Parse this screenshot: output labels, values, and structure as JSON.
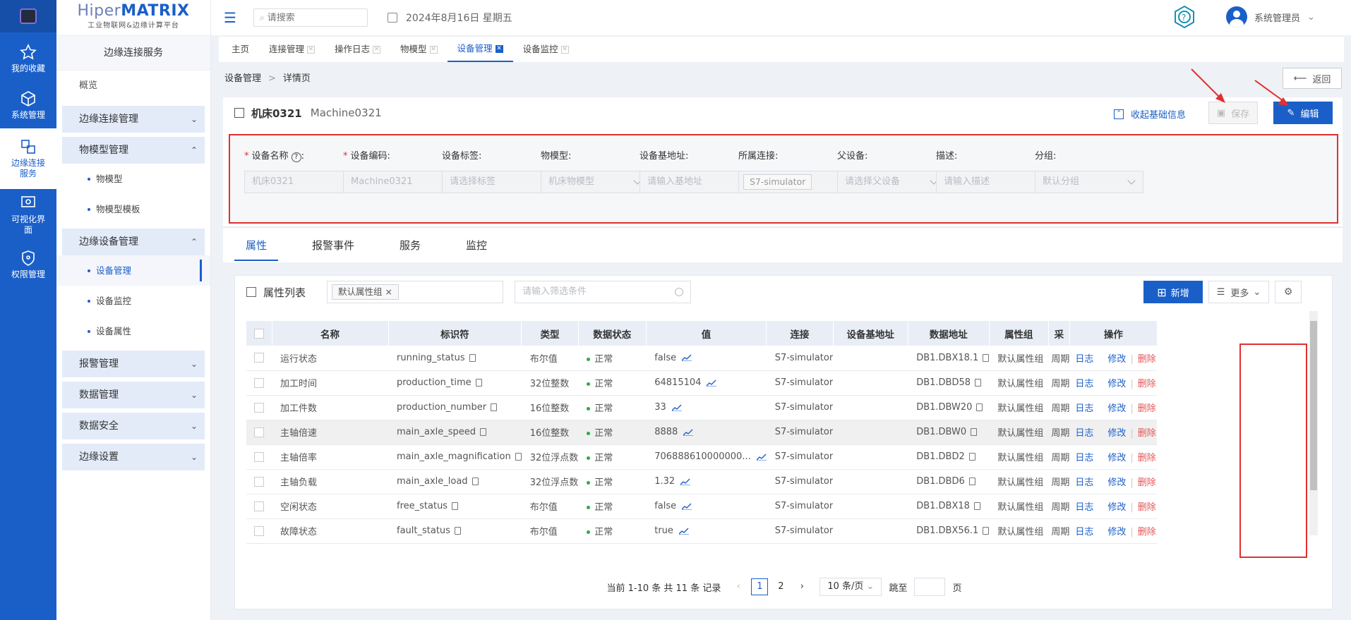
{
  "rail": {
    "items": [
      {
        "label": "我的收藏",
        "icon": "star-icon"
      },
      {
        "label": "系统管理",
        "icon": "cube-icon"
      },
      {
        "label": "边缘连接服务",
        "icon": "connection-icon"
      },
      {
        "label": "可视化界面",
        "icon": "monitor-eye-icon"
      },
      {
        "label": "权限管理",
        "icon": "shield-icon"
      }
    ]
  },
  "brand": {
    "name_prefix": "Hiper",
    "name_suffix": "MATRIX",
    "tagline": "工业物联网&边缘计算平台"
  },
  "sidebar": {
    "title": "边缘连接服务",
    "overview": "概览",
    "groups": [
      {
        "label": "边缘连接管理",
        "chev": "⌄"
      },
      {
        "label": "物模型管理",
        "chev": "⌃",
        "items": [
          "物模型",
          "物模型模板"
        ]
      },
      {
        "label": "边缘设备管理",
        "chev": "⌃",
        "items": [
          "设备管理",
          "设备监控",
          "设备属性"
        ]
      },
      {
        "label": "报警管理",
        "chev": "⌄"
      },
      {
        "label": "数据管理",
        "chev": "⌄"
      },
      {
        "label": "数据安全",
        "chev": "⌄"
      },
      {
        "label": "边缘设置",
        "chev": "⌄"
      }
    ]
  },
  "topbar": {
    "search_placeholder": "请搜索",
    "date": "2024年8月16日 星期五",
    "user": "系统管理员",
    "user_chev": "⌄"
  },
  "tabs": [
    "主页",
    "连接管理",
    "操作日志",
    "物模型",
    "设备管理",
    "设备监控"
  ],
  "tab_close": "✕",
  "breadcrumb": {
    "root": "设备管理",
    "sep": ">",
    "current": "详情页"
  },
  "back_label": "返回",
  "device": {
    "name": "机床0321",
    "code": "Machine0321"
  },
  "actions": {
    "collapse": "收起基础信息",
    "save": "保存",
    "edit": "编辑"
  },
  "form": {
    "required_mark": "*",
    "fields": [
      {
        "label": "设备名称",
        "value": "机床0321",
        "required": true,
        "help": "?"
      },
      {
        "label": "设备编码:",
        "value": "Machine0321",
        "required": true
      },
      {
        "label": "设备标签:",
        "value": "请选择标签"
      },
      {
        "label": "物模型:",
        "value": "机床物模型",
        "select": true
      },
      {
        "label": "设备基地址:",
        "value": "请输入基地址"
      },
      {
        "label": "所属连接:",
        "value": "S7-simulator",
        "chip": true
      },
      {
        "label": "父设备:",
        "value": "请选择父设备",
        "select": true
      },
      {
        "label": "描述:",
        "value": "请输入描述"
      },
      {
        "label": "分组:",
        "value": "默认分组",
        "select": true
      }
    ]
  },
  "section_tabs": [
    "属性",
    "报警事件",
    "服务",
    "监控"
  ],
  "list": {
    "title": "属性列表",
    "chip": "默认属性组",
    "chip_close": "×",
    "filter_placeholder": "请输入筛选条件",
    "add": "新增",
    "more": "更多",
    "more_chev": "⌄",
    "columns": [
      "名称",
      "标识符",
      "类型",
      "数据状态",
      "值",
      "连接",
      "设备基地址",
      "数据地址",
      "属性组",
      "采",
      "操作"
    ],
    "rows": [
      {
        "name": "运行状态",
        "id": "running_status",
        "type": "布尔值",
        "status": "正常",
        "value": "false",
        "conn": "S7-simulator",
        "base": "",
        "addr": "DB1.DBX18.1",
        "group": "默认属性组",
        "cycle": "周期"
      },
      {
        "name": "加工时间",
        "id": "production_time",
        "type": "32位整数",
        "status": "正常",
        "value": "64815104",
        "conn": "S7-simulator",
        "base": "",
        "addr": "DB1.DBD58",
        "group": "默认属性组",
        "cycle": "周期"
      },
      {
        "name": "加工件数",
        "id": "production_number",
        "type": "16位整数",
        "status": "正常",
        "value": "33",
        "conn": "S7-simulator",
        "base": "",
        "addr": "DB1.DBW20",
        "group": "默认属性组",
        "cycle": "周期"
      },
      {
        "name": "主轴倍速",
        "id": "main_axle_speed",
        "type": "16位整数",
        "status": "正常",
        "value": "8888",
        "conn": "S7-simulator",
        "base": "",
        "addr": "DB1.DBW0",
        "group": "默认属性组",
        "cycle": "周期"
      },
      {
        "name": "主轴倍率",
        "id": "main_axle_magnification",
        "type": "32位浮点数",
        "status": "正常",
        "value": "706888610000000...",
        "conn": "S7-simulator",
        "base": "",
        "addr": "DB1.DBD2",
        "group": "默认属性组",
        "cycle": "周期"
      },
      {
        "name": "主轴负载",
        "id": "main_axle_load",
        "type": "32位浮点数",
        "status": "正常",
        "value": "1.32",
        "conn": "S7-simulator",
        "base": "",
        "addr": "DB1.DBD6",
        "group": "默认属性组",
        "cycle": "周期"
      },
      {
        "name": "空闲状态",
        "id": "free_status",
        "type": "布尔值",
        "status": "正常",
        "value": "false",
        "conn": "S7-simulator",
        "base": "",
        "addr": "DB1.DBX18",
        "group": "默认属性组",
        "cycle": "周期"
      },
      {
        "name": "故障状态",
        "id": "fault_status",
        "type": "布尔值",
        "status": "正常",
        "value": "true",
        "conn": "S7-simulator",
        "base": "",
        "addr": "DB1.DBX56.1",
        "group": "默认属性组",
        "cycle": "周期"
      }
    ],
    "op_log": "日志",
    "op_edit": "修改",
    "op_sep": "|",
    "op_delete": "删除"
  },
  "pager": {
    "summary": "当前 1-10 条 共 11 条 记录",
    "prev": "‹",
    "next": "›",
    "pages": [
      "1",
      "2"
    ],
    "size": "10 条/页",
    "size_chev": "⌄",
    "goto": "跳至",
    "page_unit": "页"
  },
  "colors": {
    "primary": "#1a5fc8",
    "danger": "#e45656",
    "highlight_box": "#e03030",
    "ok": "#2eaa4a"
  }
}
